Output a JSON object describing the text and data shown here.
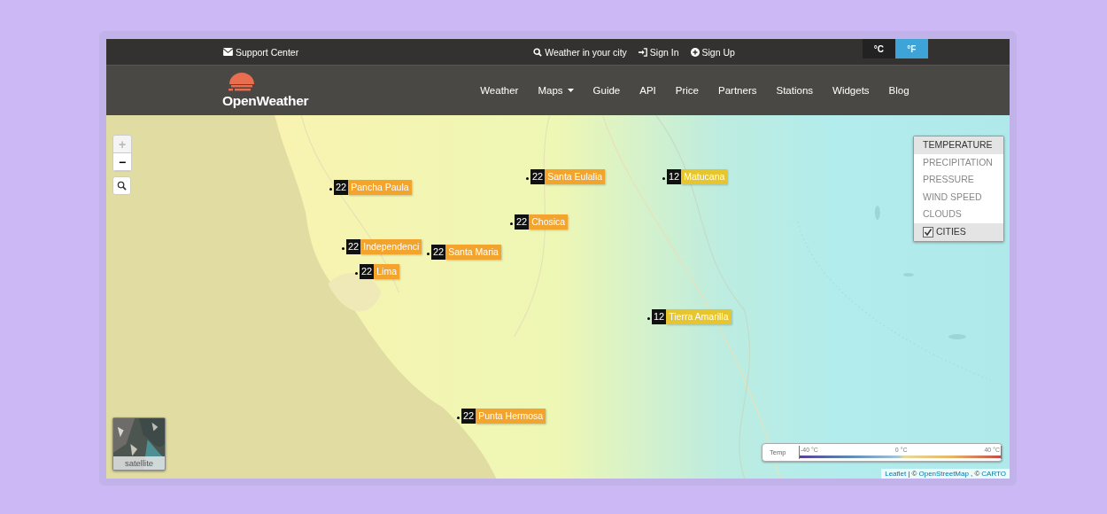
{
  "top_bar": {
    "support": "Support Center",
    "search": "Weather in your city",
    "sign_in": "Sign In",
    "sign_up": "Sign Up",
    "units": [
      {
        "label": "°C",
        "selected": false
      },
      {
        "label": "°F",
        "selected": true
      }
    ]
  },
  "nav": {
    "logo": "OpenWeather",
    "items": [
      {
        "label": "Weather",
        "dropdown": false
      },
      {
        "label": "Maps",
        "dropdown": true
      },
      {
        "label": "Guide",
        "dropdown": false
      },
      {
        "label": "API",
        "dropdown": false
      },
      {
        "label": "Price",
        "dropdown": false
      },
      {
        "label": "Partners",
        "dropdown": false
      },
      {
        "label": "Stations",
        "dropdown": false
      },
      {
        "label": "Widgets",
        "dropdown": false
      },
      {
        "label": "Blog",
        "dropdown": false
      }
    ]
  },
  "map": {
    "zoom_in": "+",
    "zoom_out": "−",
    "markers": [
      {
        "temp": "22",
        "name": "Pancha Paula",
        "color": "#f2a42c"
      },
      {
        "temp": "22",
        "name": "Santa Eulalia",
        "color": "#f2a42c"
      },
      {
        "temp": "12",
        "name": "Matucana",
        "color": "#e6c52e"
      },
      {
        "temp": "22",
        "name": "Chosica",
        "color": "#f2a42c"
      },
      {
        "temp": "22",
        "name": "Independenci",
        "color": "#f2a42c"
      },
      {
        "temp": "22",
        "name": "Santa Maria",
        "color": "#f2a42c"
      },
      {
        "temp": "22",
        "name": "Lima",
        "color": "#f2a42c"
      },
      {
        "temp": "12",
        "name": "Tierra Amarilla",
        "color": "#e6c52e"
      },
      {
        "temp": "22",
        "name": "Punta Hermosa",
        "color": "#f2a42c"
      }
    ],
    "layers": [
      {
        "label": "TEMPERATURE",
        "selected": true
      },
      {
        "label": "PRECIPITATION",
        "selected": false
      },
      {
        "label": "PRESSURE",
        "selected": false
      },
      {
        "label": "WIND SPEED",
        "selected": false
      },
      {
        "label": "CLOUDS",
        "selected": false
      }
    ],
    "cities": {
      "label": "CITIES",
      "checked": true
    },
    "satellite": "satellite",
    "legend": {
      "title": "Temp",
      "ticks": [
        "-40 °C",
        "0 °C",
        "40 °C"
      ]
    },
    "attribution": {
      "leaflet": "Leaflet",
      "sep": "| ©",
      "osm": "OpenStreetMap",
      "sep2": ", ©",
      "carto": "CARTO"
    }
  }
}
